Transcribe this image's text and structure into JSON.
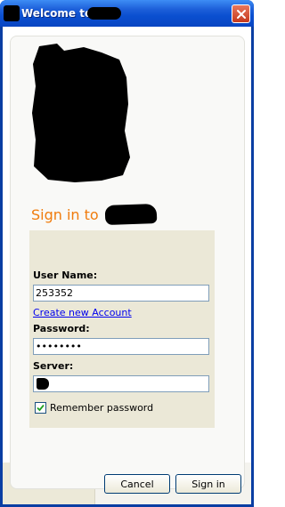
{
  "window": {
    "title": "Welcome to",
    "close_icon": "close-icon"
  },
  "form": {
    "heading": "Sign in to",
    "username_label": "User Name:",
    "username_value": "253352",
    "create_account_link": "Create new Account",
    "password_label": "Password:",
    "password_value": "••••••••",
    "server_label": "Server:",
    "server_value": "",
    "remember_label": "Remember password",
    "remember_checked": true
  },
  "buttons": {
    "cancel": "Cancel",
    "sign_in": "Sign in"
  },
  "colors": {
    "titlebar": "#0a4fd0",
    "heading_accent": "#f07c0d",
    "form_panel": "#ebe8d7",
    "link": "#0000ee"
  }
}
